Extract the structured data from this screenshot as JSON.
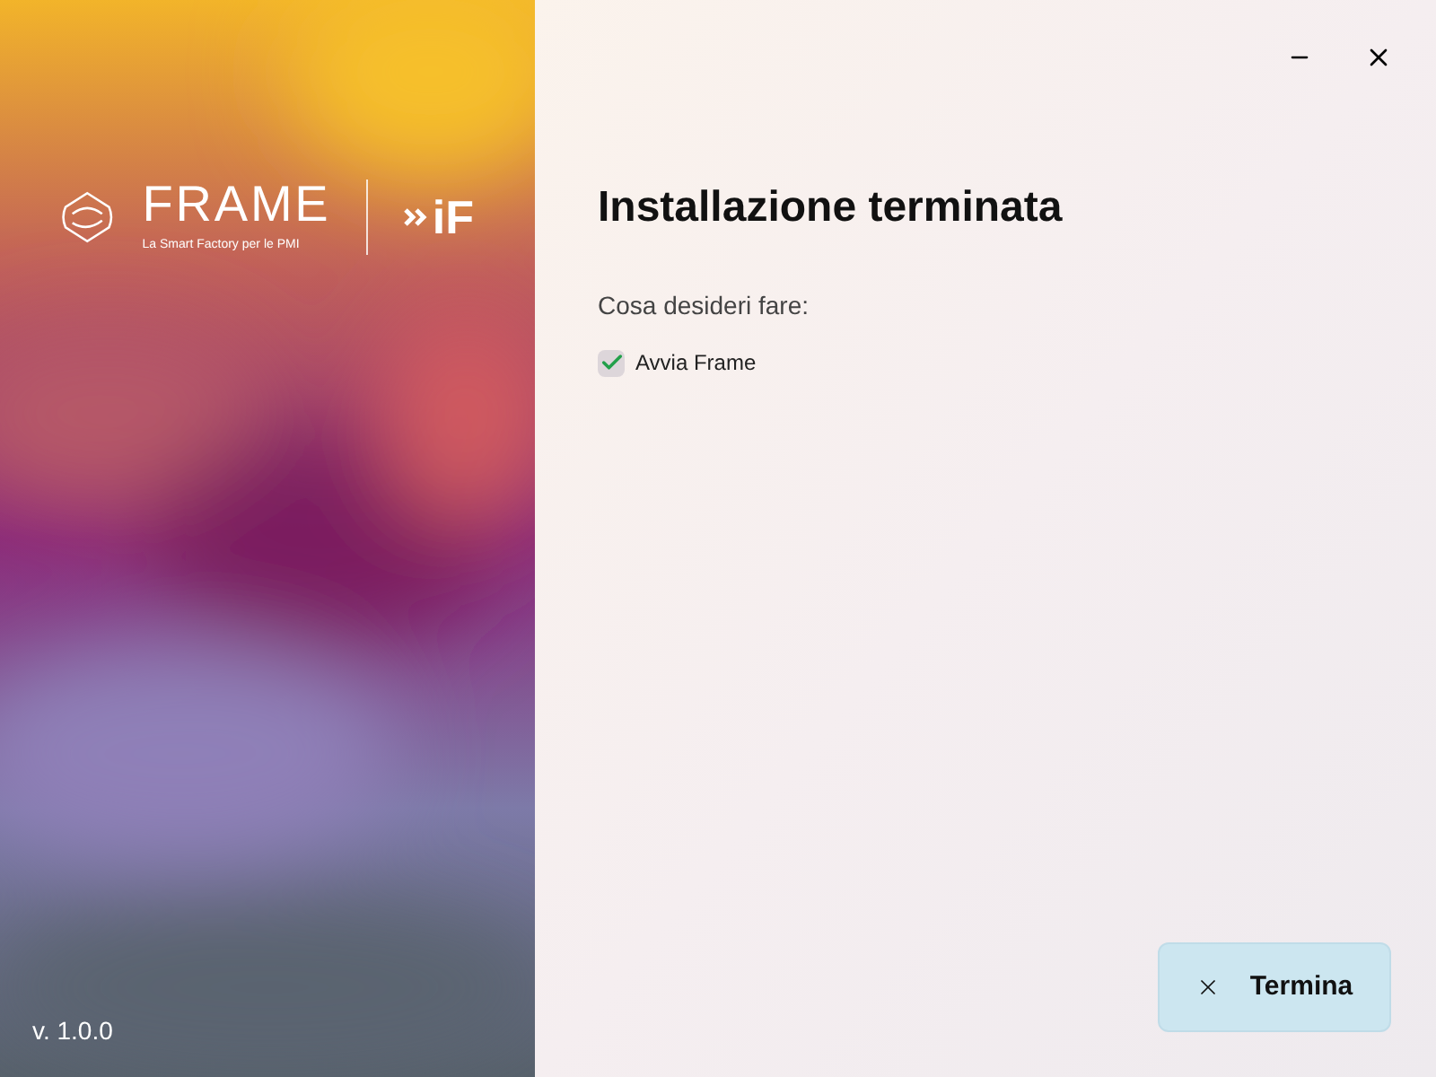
{
  "side_panel": {
    "logo": {
      "name": "FRAME",
      "tagline": "La Smart Factory per le PMI",
      "partner": "iF"
    },
    "version": "v. 1.0.0"
  },
  "title": "Installazione terminata",
  "prompt": "Cosa desideri fare:",
  "options": [
    {
      "label": "Avvia Frame",
      "checked": true
    }
  ],
  "finish_button": {
    "label": "Termina"
  }
}
